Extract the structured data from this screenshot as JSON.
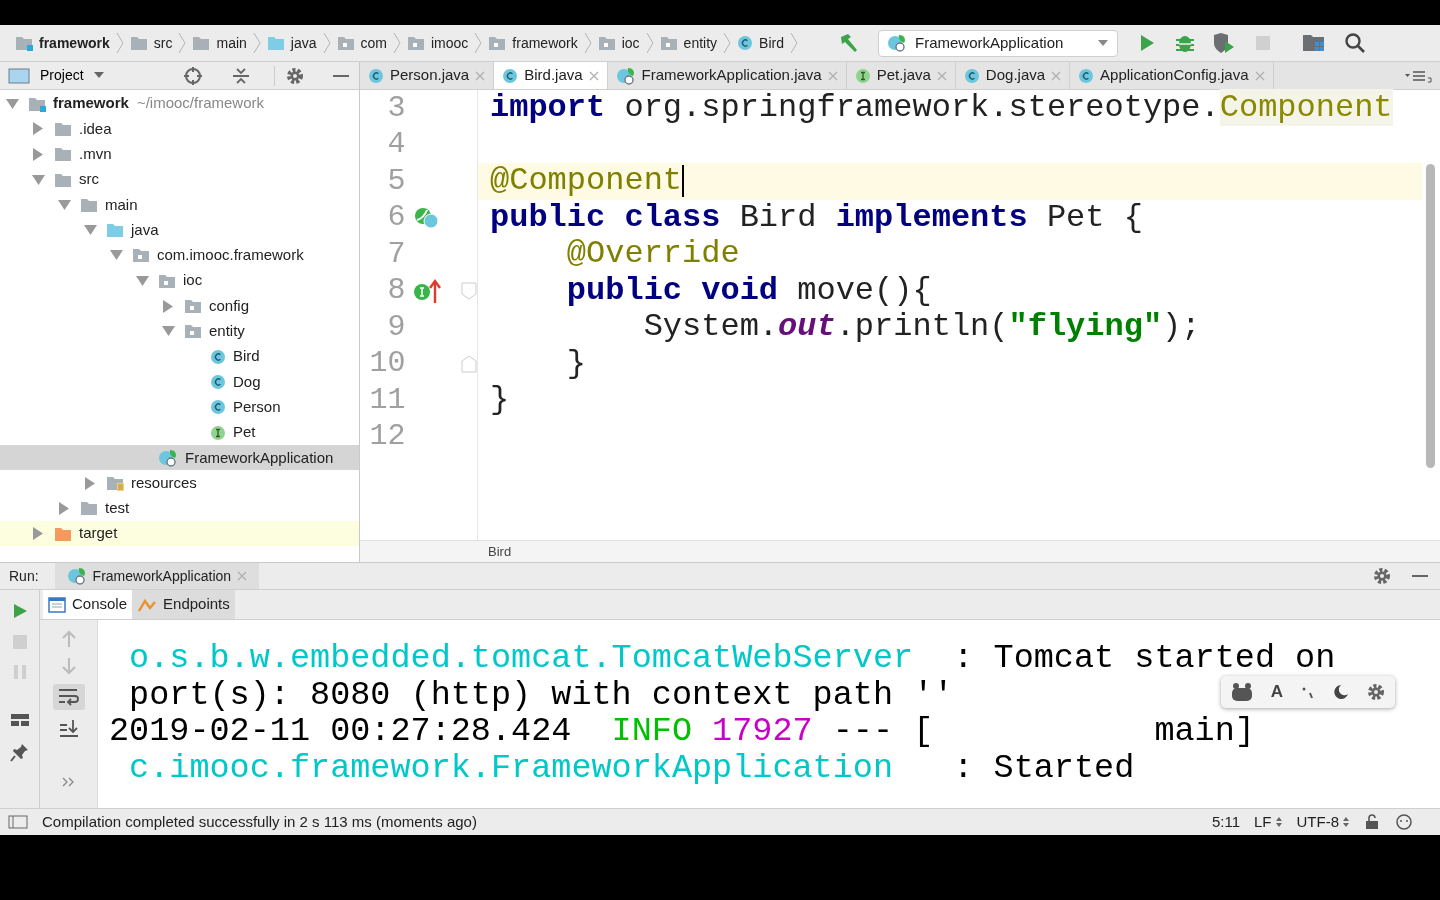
{
  "breadcrumbs": [
    {
      "label": "framework",
      "kind": "module"
    },
    {
      "label": "src",
      "kind": "folder"
    },
    {
      "label": "main",
      "kind": "folder"
    },
    {
      "label": "java",
      "kind": "source"
    },
    {
      "label": "com",
      "kind": "package"
    },
    {
      "label": "imooc",
      "kind": "package"
    },
    {
      "label": "framework",
      "kind": "package"
    },
    {
      "label": "ioc",
      "kind": "package"
    },
    {
      "label": "entity",
      "kind": "package"
    },
    {
      "label": "Bird",
      "kind": "class"
    }
  ],
  "run_config": {
    "label": "FrameworkApplication"
  },
  "project_panel": {
    "title": "Project"
  },
  "editor_tabs": [
    {
      "label": "Person.java",
      "kind": "class",
      "selected": false
    },
    {
      "label": "Bird.java",
      "kind": "class",
      "selected": true
    },
    {
      "label": "FrameworkApplication.java",
      "kind": "spring",
      "selected": false
    },
    {
      "label": "Pet.java",
      "kind": "interface",
      "selected": false
    },
    {
      "label": "Dog.java",
      "kind": "class",
      "selected": false
    },
    {
      "label": "ApplicationConfig.java",
      "kind": "class",
      "selected": false
    }
  ],
  "tree": [
    {
      "label": "framework",
      "path": "~/imooc/framework",
      "kind": "module",
      "expanded": true,
      "selected": false,
      "excluded": false,
      "children": [
        {
          "label": ".idea",
          "kind": "folder",
          "expanded": false,
          "selected": false,
          "excluded": false
        },
        {
          "label": ".mvn",
          "kind": "folder",
          "expanded": false,
          "selected": false,
          "excluded": false
        },
        {
          "label": "src",
          "kind": "folder",
          "expanded": true,
          "selected": false,
          "excluded": false,
          "children": [
            {
              "label": "main",
              "kind": "folder",
              "expanded": true,
              "selected": false,
              "excluded": false,
              "children": [
                {
                  "label": "java",
                  "kind": "source",
                  "expanded": true,
                  "selected": false,
                  "excluded": false,
                  "children": [
                    {
                      "label": "com.imooc.framework",
                      "kind": "package",
                      "expanded": true,
                      "selected": false,
                      "excluded": false,
                      "children": [
                        {
                          "label": "ioc",
                          "kind": "package",
                          "expanded": true,
                          "selected": false,
                          "excluded": false,
                          "children": [
                            {
                              "label": "config",
                              "kind": "package",
                              "expanded": false,
                              "selected": false,
                              "excluded": false
                            },
                            {
                              "label": "entity",
                              "kind": "package",
                              "expanded": true,
                              "selected": false,
                              "excluded": false,
                              "children": [
                                {
                                  "label": "Bird",
                                  "kind": "class",
                                  "selected": false,
                                  "excluded": false
                                },
                                {
                                  "label": "Dog",
                                  "kind": "class",
                                  "selected": false,
                                  "excluded": false
                                },
                                {
                                  "label": "Person",
                                  "kind": "class",
                                  "selected": false,
                                  "excluded": false
                                },
                                {
                                  "label": "Pet",
                                  "kind": "interface",
                                  "selected": false,
                                  "excluded": false
                                }
                              ]
                            }
                          ]
                        },
                        {
                          "label": "FrameworkApplication",
                          "kind": "spring",
                          "selected": true,
                          "excluded": false
                        }
                      ]
                    }
                  ]
                },
                {
                  "label": "resources",
                  "kind": "resources",
                  "expanded": false,
                  "selected": false,
                  "excluded": false
                }
              ]
            },
            {
              "label": "test",
              "kind": "folder",
              "expanded": false,
              "selected": false,
              "excluded": false
            }
          ]
        },
        {
          "label": "target",
          "kind": "folder",
          "expanded": false,
          "selected": false,
          "excluded": true
        }
      ]
    }
  ],
  "editor": {
    "lines": [
      {
        "number": "3",
        "current": false,
        "tokens": [
          {
            "text": "import",
            "kind": "keyword"
          },
          {
            "text": " org.springframework.stereotype.",
            "kind": "plain"
          },
          {
            "text": "Component",
            "kind": "reference"
          }
        ]
      },
      {
        "number": "4",
        "current": false
      },
      {
        "number": "5",
        "current": true,
        "tokens": [
          {
            "text": "@Component",
            "kind": "annotation"
          }
        ]
      },
      {
        "number": "6",
        "current": false,
        "marks": [
          {
            "kind": "bean"
          }
        ],
        "tokens": [
          {
            "text": "public class",
            "kind": "keyword"
          },
          {
            "text": " Bird ",
            "kind": "plain"
          },
          {
            "text": "implements",
            "kind": "keyword"
          },
          {
            "text": " Pet {",
            "kind": "plain"
          }
        ]
      },
      {
        "number": "7",
        "current": false,
        "tokens": [
          {
            "text": "    @Override",
            "kind": "annotation"
          }
        ]
      },
      {
        "number": "8",
        "current": false,
        "marks": [
          {
            "kind": "implements"
          },
          {
            "kind": "fold_start"
          }
        ],
        "tokens": [
          {
            "text": "    public void",
            "kind": "keyword"
          },
          {
            "text": " move(){",
            "kind": "plain"
          }
        ]
      },
      {
        "number": "9",
        "current": false,
        "tokens": [
          {
            "text": "        System.",
            "kind": "plain"
          },
          {
            "text": "out",
            "kind": "static"
          },
          {
            "text": ".println(",
            "kind": "plain"
          },
          {
            "text": "\"flying\"",
            "kind": "string"
          },
          {
            "text": ");",
            "kind": "plain"
          }
        ]
      },
      {
        "number": "10",
        "current": false,
        "marks": [
          {
            "kind": "fold_end"
          }
        ],
        "tokens": [
          {
            "text": "    }",
            "kind": "plain"
          }
        ]
      },
      {
        "number": "11",
        "current": false,
        "tokens": [
          {
            "text": "}",
            "kind": "plain"
          }
        ]
      },
      {
        "number": "12",
        "current": false
      }
    ],
    "file_breadcrumb": "Bird"
  },
  "run_panel": {
    "label": "Run:",
    "tab": "FrameworkApplication",
    "console_tabs": [
      {
        "label": "Console",
        "kind": "console",
        "selected": true
      },
      {
        "label": "Endpoints",
        "kind": "endpoints",
        "selected": false
      }
    ],
    "console_lines": [
      [
        {
          "text": " o.s.b.w.embedded.tomcat.TomcatWebServer",
          "kind": "logger"
        },
        {
          "text": "  : Tomcat started on",
          "kind": "plain"
        }
      ],
      [
        {
          "text": " port(s): 8080 (http) with context path ''",
          "kind": "plain"
        }
      ],
      [
        {
          "text": "2019-02-11 00:27:28.424  ",
          "kind": "plain"
        },
        {
          "text": "INFO",
          "kind": "level"
        },
        {
          "text": " 17927",
          "kind": "pid"
        },
        {
          "text": " --- [           main]",
          "kind": "plain"
        }
      ],
      [
        {
          "text": " c.imooc.framework.FrameworkApplication",
          "kind": "logger"
        },
        {
          "text": "   : Started",
          "kind": "plain"
        }
      ]
    ]
  },
  "ime_toolbar": {
    "font_label": "A"
  },
  "status_bar": {
    "message": "Compilation completed successfully in 2 s 113 ms (moments ago)",
    "position": "5:11",
    "line_separator": "LF",
    "encoding": "UTF-8"
  }
}
